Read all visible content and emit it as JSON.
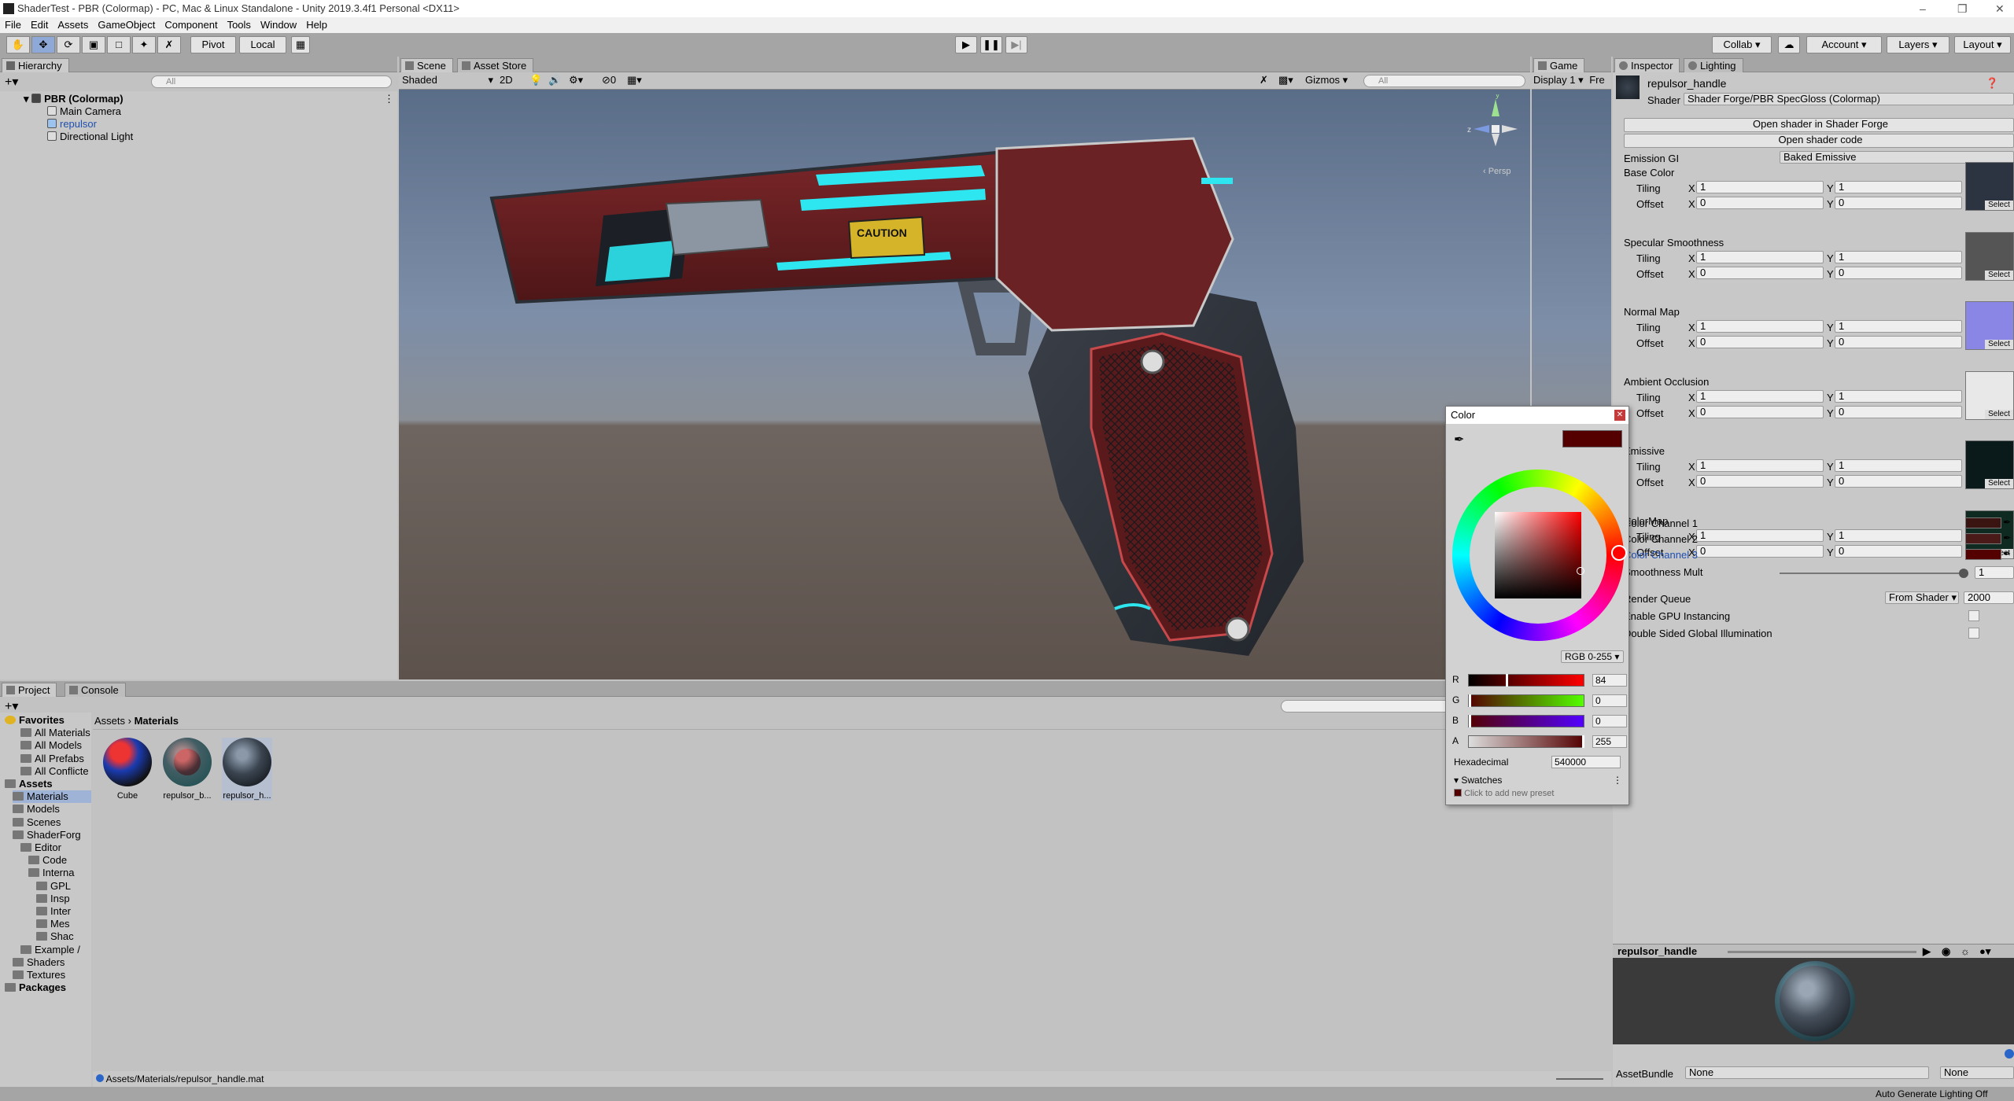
{
  "window": {
    "title": "ShaderTest - PBR (Colormap) - PC, Mac & Linux Standalone - Unity 2019.3.4f1 Personal <DX11>"
  },
  "menu": [
    "File",
    "Edit",
    "Assets",
    "GameObject",
    "Component",
    "Tools",
    "Window",
    "Help"
  ],
  "toolbar": {
    "pivot": "Pivot",
    "local": "Local",
    "collab": "Collab",
    "account": "Account",
    "layers": "Layers",
    "layout": "Layout"
  },
  "hierarchy": {
    "tab": "Hierarchy",
    "search_placeholder": "All",
    "scene": "PBR (Colormap)",
    "items": [
      "Main Camera",
      "repulsor",
      "Directional Light"
    ]
  },
  "scene": {
    "tab": "Scene",
    "asset_store_tab": "Asset Store",
    "shading": "Shaded",
    "mode_2d": "2D",
    "hidden_count": "0",
    "gizmos": "Gizmos",
    "search_placeholder": "All",
    "persp": "‹ Persp",
    "axis_y": "y",
    "axis_z": "z",
    "caution": "CAUTION"
  },
  "game": {
    "tab": "Game",
    "display": "Display 1",
    "free": "Fre"
  },
  "project": {
    "tab": "Project",
    "console_tab": "Console",
    "breadcrumb": [
      "Assets",
      "Materials"
    ],
    "tree": [
      {
        "label": "Favorites",
        "indent": 0,
        "bold": true
      },
      {
        "label": "All Materials",
        "indent": 2,
        "bold": false
      },
      {
        "label": "All Models",
        "indent": 2,
        "bold": false
      },
      {
        "label": "All Prefabs",
        "indent": 2,
        "bold": false
      },
      {
        "label": "All Conflicte",
        "indent": 2,
        "bold": false
      },
      {
        "label": "Assets",
        "indent": 0,
        "bold": true
      },
      {
        "label": "Materials",
        "indent": 1,
        "bold": false
      },
      {
        "label": "Models",
        "indent": 1,
        "bold": false
      },
      {
        "label": "Scenes",
        "indent": 1,
        "bold": false
      },
      {
        "label": "ShaderForg",
        "indent": 1,
        "bold": false
      },
      {
        "label": "Editor",
        "indent": 2,
        "bold": false
      },
      {
        "label": "Code",
        "indent": 3,
        "bold": false
      },
      {
        "label": "Interna",
        "indent": 3,
        "bold": false
      },
      {
        "label": "GPL",
        "indent": 4,
        "bold": false
      },
      {
        "label": "Insp",
        "indent": 4,
        "bold": false
      },
      {
        "label": "Inter",
        "indent": 4,
        "bold": false
      },
      {
        "label": "Mes",
        "indent": 4,
        "bold": false
      },
      {
        "label": "Shac",
        "indent": 4,
        "bold": false
      },
      {
        "label": "Example /",
        "indent": 2,
        "bold": false
      },
      {
        "label": "Shaders",
        "indent": 1,
        "bold": false
      },
      {
        "label": "Textures",
        "indent": 1,
        "bold": false
      },
      {
        "label": "Packages",
        "indent": 0,
        "bold": true
      }
    ],
    "assets": [
      "Cube",
      "repulsor_b...",
      "repulsor_h..."
    ],
    "path": "Assets/Materials/repulsor_handle.mat"
  },
  "inspector": {
    "tab": "Inspector",
    "lighting_tab": "Lighting",
    "material": "repulsor_handle",
    "shader_label": "Shader",
    "shader": "Shader Forge/PBR SpecGloss (Colormap)",
    "open_sf": "Open shader in Shader Forge",
    "open_code": "Open shader code",
    "emission_gi_label": "Emission GI",
    "emission_gi": "Baked Emissive",
    "tiling": "Tiling",
    "offset": "Offset",
    "x": "X",
    "y": "Y",
    "select": "Select",
    "textures": [
      {
        "name": "Base Color",
        "tiling": [
          "1",
          "1"
        ],
        "offset": [
          "0",
          "0"
        ],
        "color": "#2b3440"
      },
      {
        "name": "Specular Smoothness",
        "tiling": [
          "1",
          "1"
        ],
        "offset": [
          "0",
          "0"
        ],
        "color": "#555555"
      },
      {
        "name": "Normal Map",
        "tiling": [
          "1",
          "1"
        ],
        "offset": [
          "0",
          "0"
        ],
        "color": "#8a86e6"
      },
      {
        "name": "Ambient Occlusion",
        "tiling": [
          "1",
          "1"
        ],
        "offset": [
          "0",
          "0"
        ],
        "color": "#e8e8e8"
      },
      {
        "name": "Emissive",
        "tiling": [
          "1",
          "1"
        ],
        "offset": [
          "0",
          "0"
        ],
        "color": "#0a1a1a"
      },
      {
        "name": "ColorMap",
        "tiling": [
          "1",
          "1"
        ],
        "offset": [
          "0",
          "0"
        ],
        "color": "#0f2a20"
      }
    ],
    "channels": [
      {
        "name": "Color Channel 1",
        "color": "#3a1410"
      },
      {
        "name": "Color Channel 2",
        "color": "#4a1a18"
      },
      {
        "name": "Color Channel 3",
        "color": "#540000"
      }
    ],
    "smoothness_label": "Smoothness Mult",
    "smoothness": "1",
    "smoothness_fraction": 1.0,
    "render_queue_label": "Render Queue",
    "render_queue_mode": "From Shader",
    "render_queue": "2000",
    "gpu_instancing": "Enable GPU Instancing",
    "double_sided_gi": "Double Sided Global Illumination",
    "preview_title": "repulsor_handle",
    "asset_bundle_label": "AssetBundle",
    "asset_bundle": "None",
    "asset_bundle_variant": "None"
  },
  "color_picker": {
    "title": "Color",
    "mode": "RGB 0-255",
    "r_label": "R",
    "r": "84",
    "r_fraction": 0.329,
    "g_label": "G",
    "g": "0",
    "g_fraction": 0,
    "b_label": "B",
    "b": "0",
    "b_fraction": 0,
    "a_label": "A",
    "a": "255",
    "a_fraction": 1.0,
    "hex_label": "Hexadecimal",
    "hex": "540000",
    "swatches": "Swatches",
    "add_preset": "Click to add new preset",
    "color": "#540000"
  },
  "status": {
    "lighting": "Auto Generate Lighting Off"
  }
}
